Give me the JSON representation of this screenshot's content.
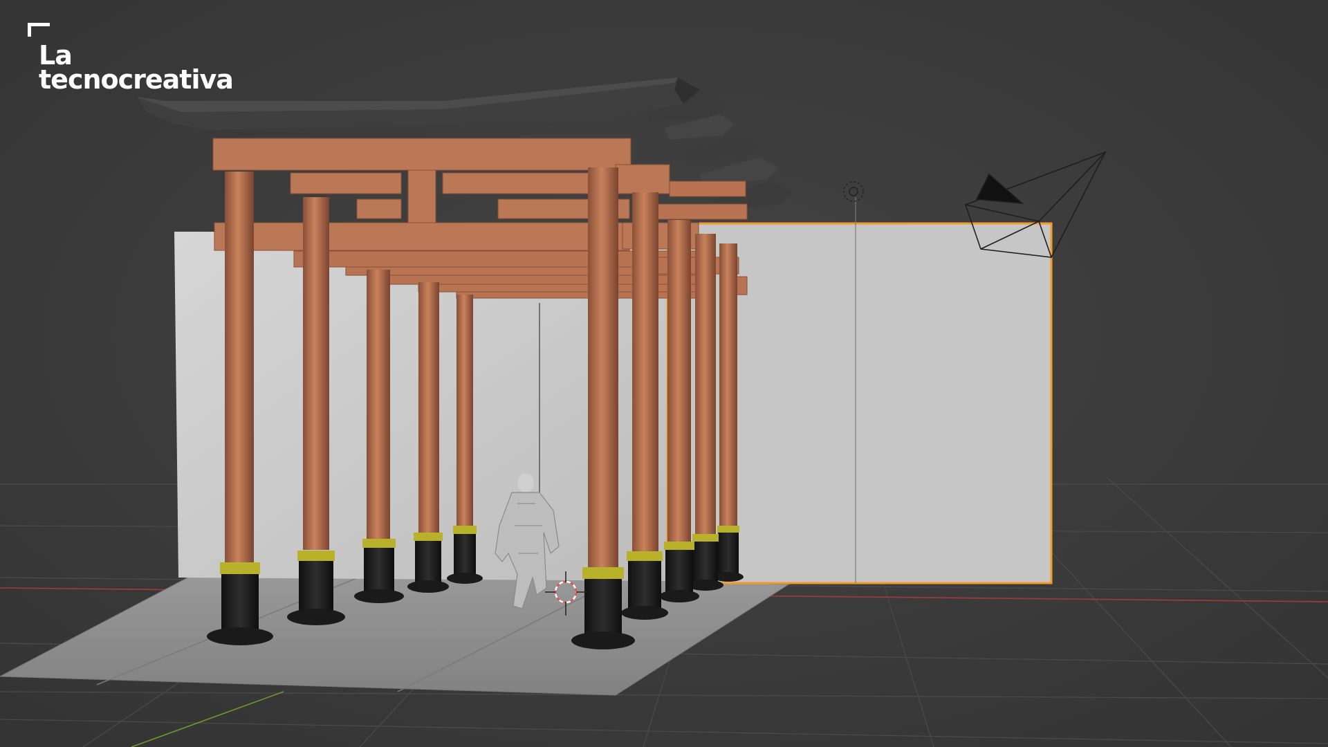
{
  "app": {
    "name": "3D viewport"
  },
  "brand": {
    "line1": "La",
    "line2": "tecnocreativa",
    "logo_color": "#ffffff"
  },
  "scene": {
    "objects": [
      "ground-plane",
      "backdrop-wall",
      "torii-gate",
      "kimono-figure",
      "selected-plane",
      "light-source",
      "camera",
      "3d-cursor"
    ],
    "colors": {
      "background": "#3d3d3d",
      "grid": "#4a4a4a",
      "x_axis": "#a23a3f",
      "y_axis": "#6b9a2e",
      "pillar": "#b87452",
      "pillar_base": "#1e1e1e",
      "ring": "#b8b22a",
      "roof": "#444444",
      "wall": "#c8c8c8",
      "floor": "#8c8c8c",
      "selection": "#f39a2a"
    }
  }
}
